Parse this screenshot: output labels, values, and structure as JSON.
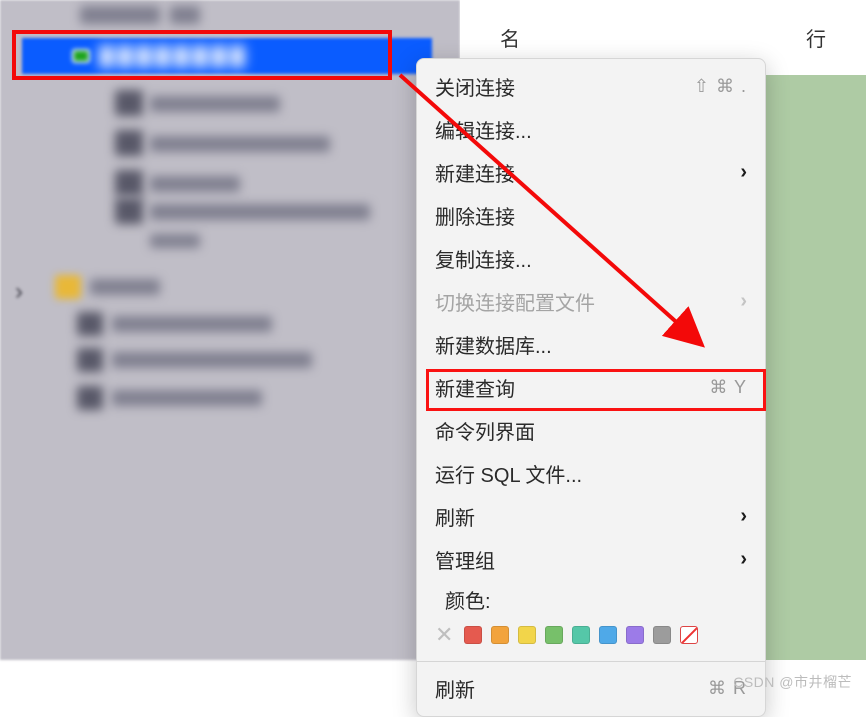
{
  "header": {
    "col_name": "名",
    "col_row": "行"
  },
  "menu": {
    "close_connection": "关闭连接",
    "close_shortcut": "⇧ ⌘ .",
    "edit_connection": "编辑连接...",
    "new_connection": "新建连接",
    "delete_connection": "删除连接",
    "duplicate_connection": "复制连接...",
    "switch_profile": "切换连接配置文件",
    "new_database": "新建数据库...",
    "new_query": "新建查询",
    "new_query_shortcut": "⌘ Y",
    "cli": "命令列界面",
    "run_sql_file": "运行 SQL 文件...",
    "refresh": "刷新",
    "manage_group": "管理组",
    "color_label": "颜色:",
    "refresh2": "刷新",
    "refresh_shortcut": "⌘ R"
  },
  "colors": [
    "#e55a4f",
    "#f2a33c",
    "#f2d54a",
    "#77c06a",
    "#55c7a8",
    "#4fa9e8",
    "#9c7be8",
    "#9c9c9c"
  ],
  "watermark": "CSDN @市井榴芒"
}
